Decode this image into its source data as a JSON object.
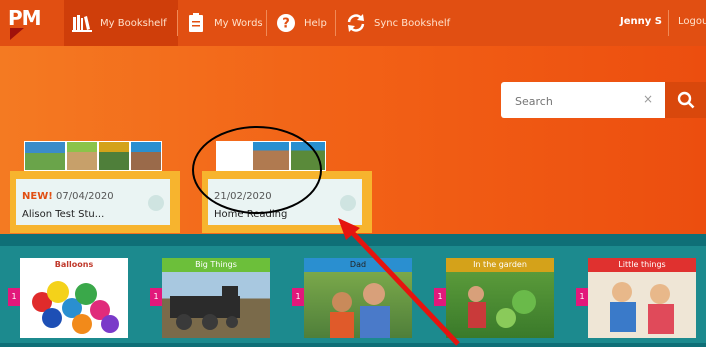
{
  "nav": {
    "logo": "PM",
    "items": [
      {
        "label": "My Bookshelf",
        "icon": "bookshelf-icon"
      },
      {
        "label": "My Words",
        "icon": "clipboard-icon"
      },
      {
        "label": "Help",
        "icon": "help-icon"
      },
      {
        "label": "Sync Bookshelf",
        "icon": "sync-icon"
      }
    ],
    "user": "Jenny S",
    "logout": "Logout"
  },
  "search": {
    "placeholder": "Search",
    "clear": "×"
  },
  "bookshelves": [
    {
      "new_label": "NEW!",
      "date": "07/04/2020",
      "title": "Alison Test Stu..."
    },
    {
      "date": "21/02/2020",
      "title": "Home Reading"
    }
  ],
  "books": [
    {
      "title": "Balloons",
      "level": "1",
      "color": "#ffffff"
    },
    {
      "title": "Big Things",
      "level": "1",
      "color": "#6cbf3a"
    },
    {
      "title": "Dad",
      "level": "1",
      "color": "#2a8fd0"
    },
    {
      "title": "In the garden",
      "level": "1",
      "color": "#d4a21a"
    },
    {
      "title": "Little things",
      "level": "1",
      "color": "#e0312f"
    }
  ],
  "colors": {
    "nav": "#e14f12",
    "hero": "#f26a1a",
    "teal": "#0f6f77",
    "annotation_arrow": "#e5140f"
  }
}
